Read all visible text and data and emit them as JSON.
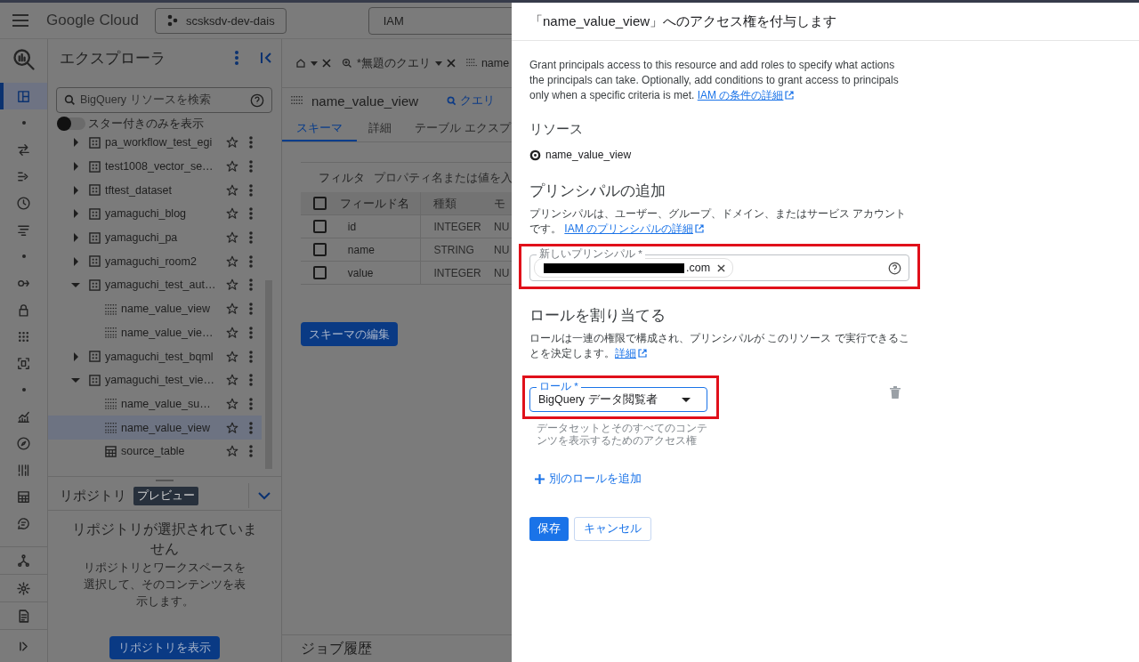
{
  "header": {
    "logo": "Google Cloud",
    "project": "scsksdv-dev-dais",
    "search": "IAM"
  },
  "rail": {
    "top": [
      {
        "kind": "logo",
        "selected": false
      },
      {
        "kind": "panels",
        "selected": true
      },
      {
        "kind": "dot",
        "selected": false
      },
      {
        "kind": "swap",
        "selected": false
      },
      {
        "kind": "pipeline",
        "selected": false
      },
      {
        "kind": "clock",
        "selected": false
      },
      {
        "kind": "lines",
        "selected": false
      },
      {
        "kind": "dot",
        "selected": false
      },
      {
        "kind": "flow",
        "selected": false
      },
      {
        "kind": "lock",
        "selected": false
      },
      {
        "kind": "grid",
        "selected": false
      },
      {
        "kind": "frame",
        "selected": false
      },
      {
        "kind": "dot",
        "selected": false
      },
      {
        "kind": "chart",
        "selected": false
      },
      {
        "kind": "compass",
        "selected": false
      },
      {
        "kind": "dashboard",
        "selected": false
      },
      {
        "kind": "table",
        "selected": false
      },
      {
        "kind": "chat",
        "selected": false
      }
    ],
    "bottom": [
      {
        "kind": "hub",
        "selected": false
      },
      {
        "kind": "gear",
        "selected": false
      },
      {
        "kind": "doc",
        "selected": false
      },
      {
        "kind": "expand",
        "selected": false
      }
    ]
  },
  "explorer": {
    "title": "エクスプローラ",
    "search_placeholder": "BigQuery リソースを検索",
    "starred_toggle": {
      "label": "スター付きのみを表示",
      "on": false
    },
    "tree": [
      {
        "name": "pa_workflow_test_egi",
        "kind": "dataset",
        "expanded": false,
        "selected": false
      },
      {
        "name": "test1008_vector_se…",
        "kind": "dataset",
        "expanded": false,
        "selected": false
      },
      {
        "name": "tftest_dataset",
        "kind": "dataset",
        "expanded": false,
        "selected": false
      },
      {
        "name": "yamaguchi_blog",
        "kind": "dataset",
        "expanded": false,
        "selected": false
      },
      {
        "name": "yamaguchi_pa",
        "kind": "dataset",
        "expanded": false,
        "selected": false
      },
      {
        "name": "yamaguchi_room2",
        "kind": "dataset",
        "expanded": false,
        "selected": false
      },
      {
        "name": "yamaguchi_test_aut…",
        "kind": "dataset",
        "expanded": true,
        "selected": false,
        "children": [
          {
            "name": "name_value_view",
            "kind": "view",
            "selected": false
          },
          {
            "name": "name_value_vie…",
            "kind": "view",
            "selected": false
          }
        ]
      },
      {
        "name": "yamaguchi_test_bqml",
        "kind": "dataset",
        "expanded": false,
        "selected": false
      },
      {
        "name": "yamaguchi_test_vie…",
        "kind": "dataset",
        "expanded": true,
        "selected": false,
        "children": [
          {
            "name": "name_value_su…",
            "kind": "view",
            "selected": false
          },
          {
            "name": "name_value_view",
            "kind": "view",
            "selected": true
          },
          {
            "name": "source_table",
            "kind": "table",
            "selected": false
          }
        ]
      }
    ]
  },
  "repository": {
    "title": "リポジトリ",
    "badge": "プレビュー",
    "empty_title": "リポジトリが選択されていません",
    "empty_text": "リポジトリとワークスペースを選択して、そのコンテンツを表示します。",
    "button": "リポジトリを表示"
  },
  "editor_tabs": [
    {
      "kind": "home"
    },
    {
      "kind": "query",
      "label": "*無題のクエリ"
    },
    {
      "kind": "view",
      "label": "name"
    }
  ],
  "view": {
    "title": "name_value_view",
    "query_button": "クエリ",
    "tabs": [
      {
        "label": "スキーマ",
        "selected": true
      },
      {
        "label": "詳細",
        "selected": false
      },
      {
        "label": "テーブル エクスプ",
        "selected": false
      }
    ],
    "filter": {
      "label": "フィルタ",
      "placeholder": "プロパティ名または値を入"
    },
    "table": {
      "checked": false,
      "columns": [
        "フィールド名",
        "種類",
        "モ"
      ],
      "rows": [
        {
          "checked": false,
          "cells": [
            "id",
            "INTEGER",
            "NU"
          ]
        },
        {
          "checked": false,
          "cells": [
            "name",
            "STRING",
            "NU"
          ]
        },
        {
          "checked": false,
          "cells": [
            "value",
            "INTEGER",
            "NU"
          ]
        }
      ]
    },
    "edit_button": "スキーマの編集"
  },
  "job_history": "ジョブ履歴",
  "dialog": {
    "title": "「name_value_view」へのアクセス権を付与します",
    "intro": "Grant principals access to this resource and add roles to specify what actions the principals can take. Optionally, add conditions to grant access to principals only when a specific criteria is met.",
    "intro_link": "IAM の条件の詳細",
    "resource_heading": "リソース",
    "resource": "name_value_view",
    "principals_heading": "プリンシパルの追加",
    "principals_text": "プリンシパルは、ユーザー、グループ、ドメイン、またはサービス アカウントです。",
    "principals_link": "IAM のプリンシパルの詳細",
    "principal_field": {
      "label": "新しいプリンシパル *",
      "chips": [
        ".com"
      ]
    },
    "roles_heading": "ロールを割り当てる",
    "roles_text": "ロールは一連の権限で構成され、プリンシパルが このリソース で実行できることを決定します。",
    "roles_link": "詳細",
    "role_field": {
      "label": "ロール *",
      "value": "BigQuery データ閲覧者",
      "hint": "データセットとそのすべてのコンテンツを表示するためのアクセス権"
    },
    "add_role": "別のロールを追加",
    "save": "保存",
    "cancel": "キャンセル"
  }
}
